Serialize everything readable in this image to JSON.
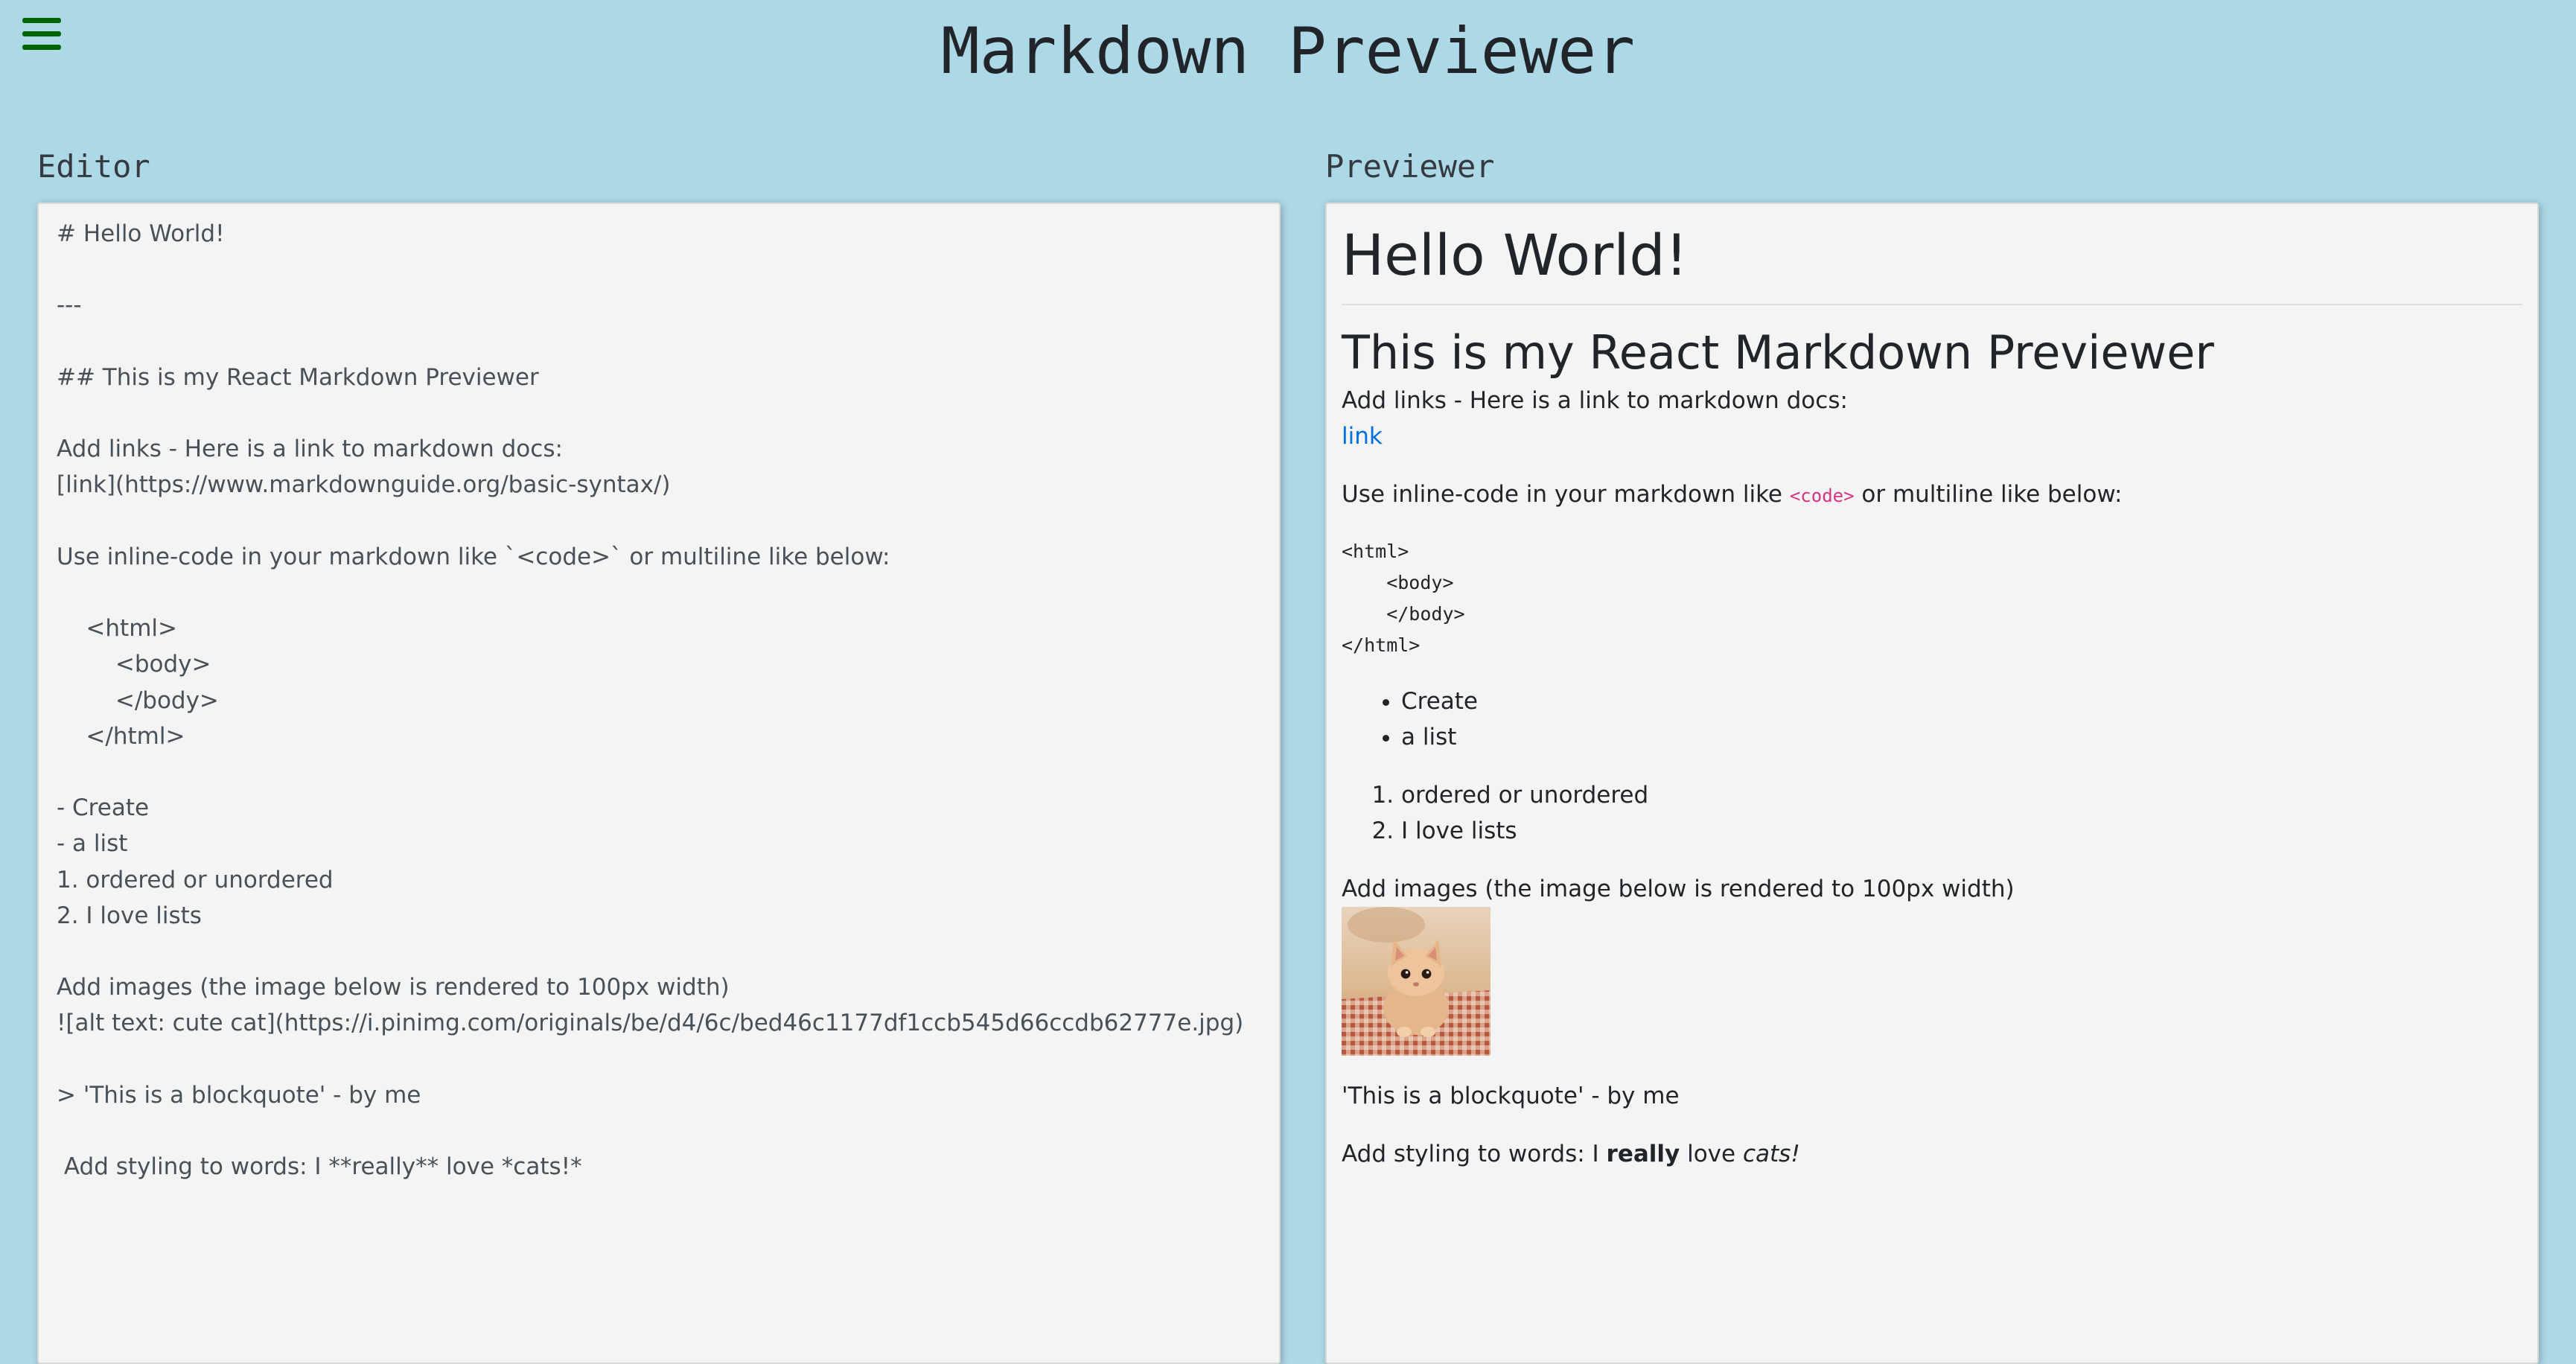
{
  "header": {
    "title": "Markdown Previewer",
    "menu_icon": "hamburger-menu-icon",
    "menu_color": "#006400"
  },
  "colors": {
    "background": "#add8e6",
    "panel_background": "#f4f4f4",
    "link": "#0070e0",
    "inline_code": "#d63384"
  },
  "editor": {
    "label": "Editor",
    "content": "# Hello World!\n\n---\n\n## This is my React Markdown Previewer\n\nAdd links - Here is a link to markdown docs:\n[link](https://www.markdownguide.org/basic-syntax/)\n\nUse inline-code in your markdown like `<code>` or multiline like below:\n\n\t<html>\n\t\t<body>\n\t\t</body>\n\t</html>\n\n- Create\n- a list\n1. ordered or unordered\n2. I love lists\n\nAdd images (the image below is rendered to 100px width)\n![alt text: cute cat](https://i.pinimg.com/originals/be/d4/6c/bed46c1177df1ccb545d66ccdb62777e.jpg)\n\n> 'This is a blockquote' - by me\n\n Add styling to words: I **really** love *cats!*"
  },
  "previewer": {
    "label": "Previewer",
    "h1": "Hello World!",
    "h2": "This is my React Markdown Previewer",
    "links_text": "Add links - Here is a link to markdown docs:",
    "link_label": "link",
    "inline_code_prefix": "Use inline-code in your markdown like ",
    "inline_code": "<code>",
    "inline_code_suffix": " or multiline like below:",
    "code_block": "<html>\n    <body>\n    </body>\n</html>",
    "unordered_list": [
      "Create",
      "a list"
    ],
    "ordered_list": [
      "ordered or unordered",
      "I love lists"
    ],
    "images_text": "Add images (the image below is rendered to 100px width)",
    "image_alt": "alt text: cute cat",
    "blockquote": "'This is a blockquote' - by me",
    "styling_prefix": "Add styling to words: I ",
    "styling_bold": "really",
    "styling_middle": " love ",
    "styling_italic": "cats!"
  }
}
